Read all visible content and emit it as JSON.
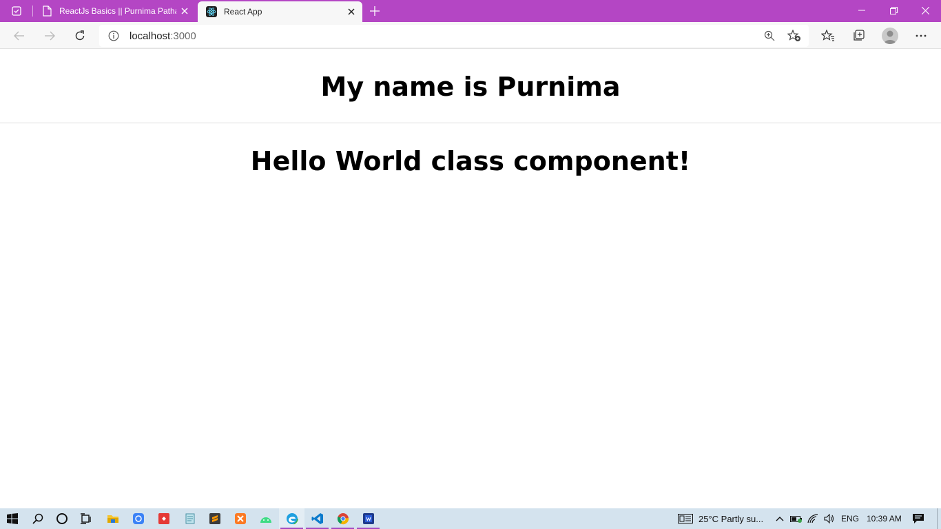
{
  "browser": {
    "tabs": [
      {
        "title": "ReactJs Basics || Purnima Pathak",
        "active": false,
        "icon": "page-icon"
      },
      {
        "title": "React App",
        "active": true,
        "icon": "react-logo-icon"
      }
    ],
    "address": {
      "host": "localhost",
      "port": ":3000"
    },
    "accent_color": "#b446c4"
  },
  "page": {
    "heading_name": "My name is Purnima",
    "heading_hello": "Hello World class component!"
  },
  "taskbar": {
    "apps": [
      "windows-start-icon",
      "search-icon",
      "cortana-icon",
      "task-view-icon",
      "file-explorer-icon",
      "app-icon-blue",
      "app-icon-red",
      "notepad-icon",
      "sublime-text-icon",
      "xampp-icon",
      "android-studio-icon",
      "edge-icon",
      "vscode-icon",
      "chrome-icon",
      "word-app-icon"
    ],
    "weather": "25°C  Partly su...",
    "language": "ENG",
    "time": "10:39 AM"
  }
}
